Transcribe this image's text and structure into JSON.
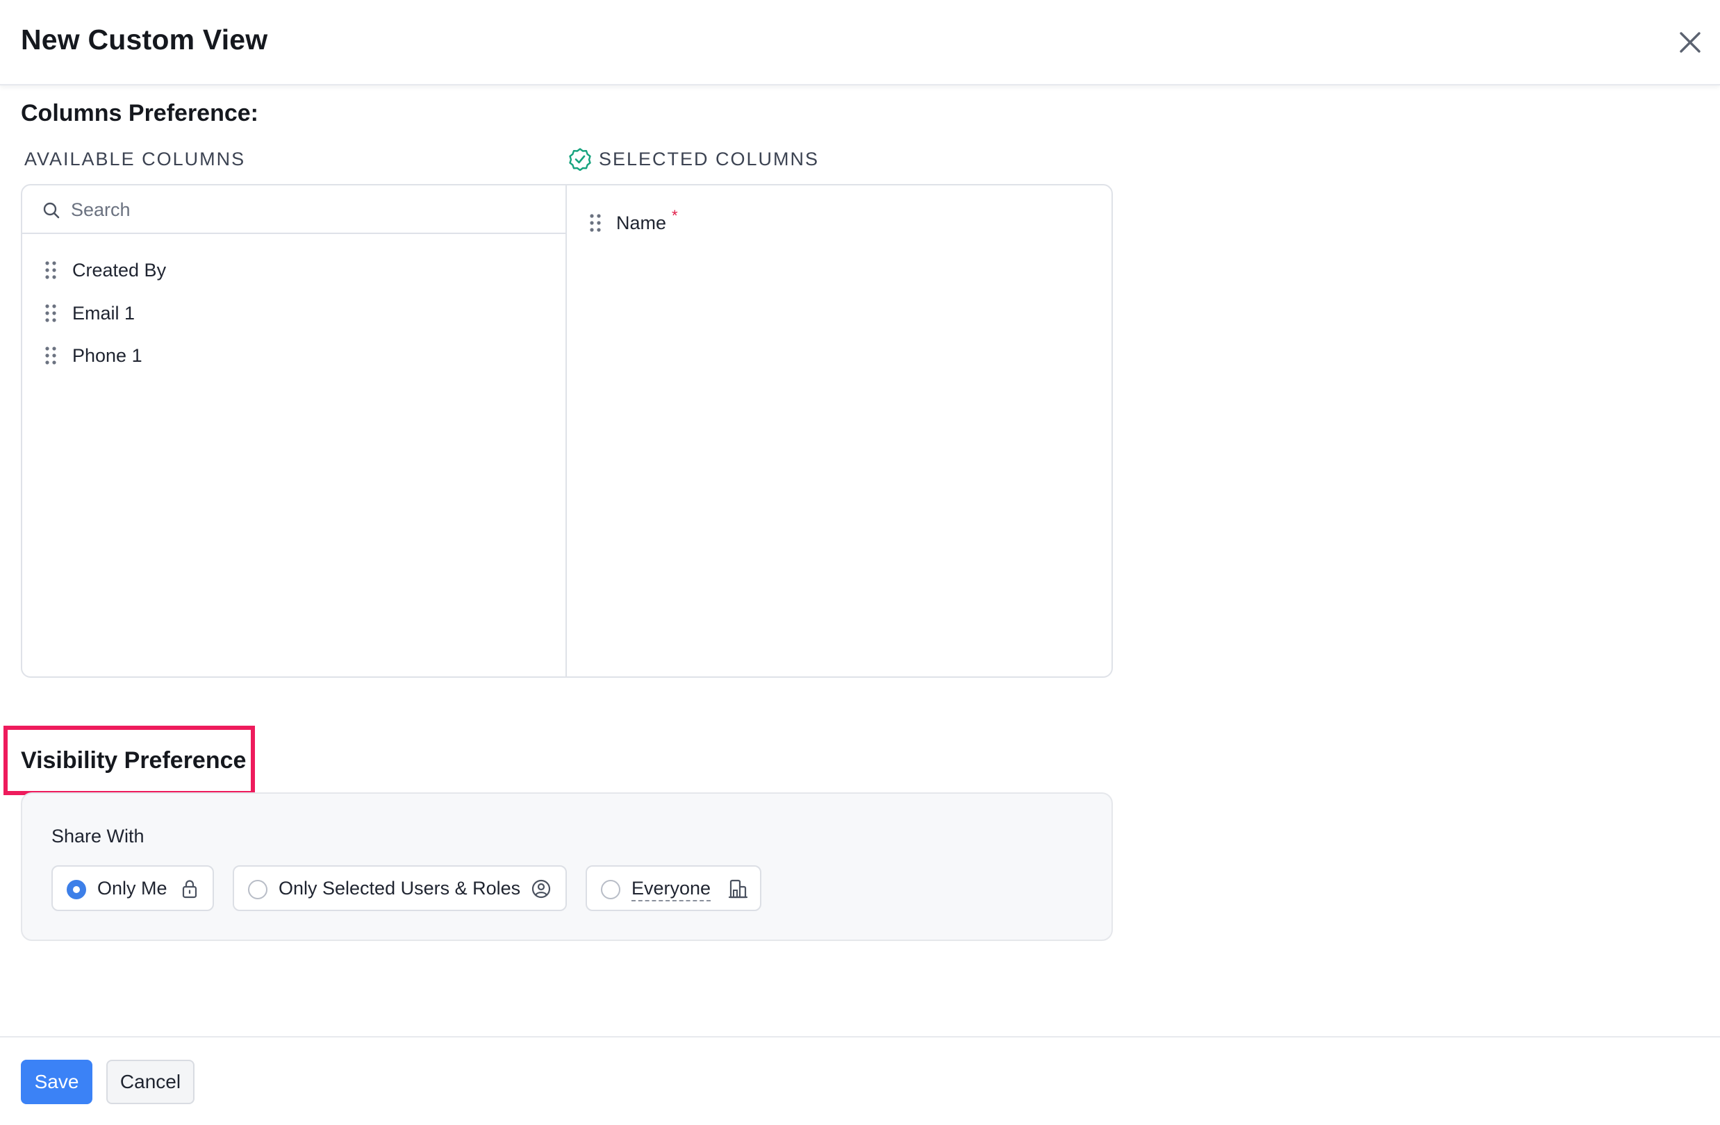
{
  "header": {
    "title": "New Custom View",
    "close_icon": "close-icon"
  },
  "columns_preference": {
    "title": "Columns Preference:",
    "available": {
      "heading": "AVAILABLE COLUMNS",
      "search_placeholder": "Search",
      "items": [
        {
          "label": "Created By"
        },
        {
          "label": "Email 1"
        },
        {
          "label": "Phone 1"
        }
      ]
    },
    "selected": {
      "heading": "SELECTED COLUMNS",
      "heading_icon": "check-badge-icon",
      "items": [
        {
          "label": "Name",
          "required": "*"
        }
      ]
    }
  },
  "visibility_preference": {
    "title": "Visibility Preference",
    "share_with_label": "Share With",
    "options": [
      {
        "label": "Only Me",
        "icon": "lock-icon",
        "checked": true
      },
      {
        "label": "Only Selected Users & Roles",
        "icon": "user-circle-icon",
        "checked": false
      },
      {
        "label": "Everyone",
        "icon": "building-icon",
        "checked": false
      }
    ]
  },
  "footer": {
    "save_label": "Save",
    "cancel_label": "Cancel"
  },
  "colors": {
    "primary": "#3b82f6",
    "highlight": "#ee1b5c",
    "required": "#e11d48",
    "check_badge": "#16a37e"
  }
}
